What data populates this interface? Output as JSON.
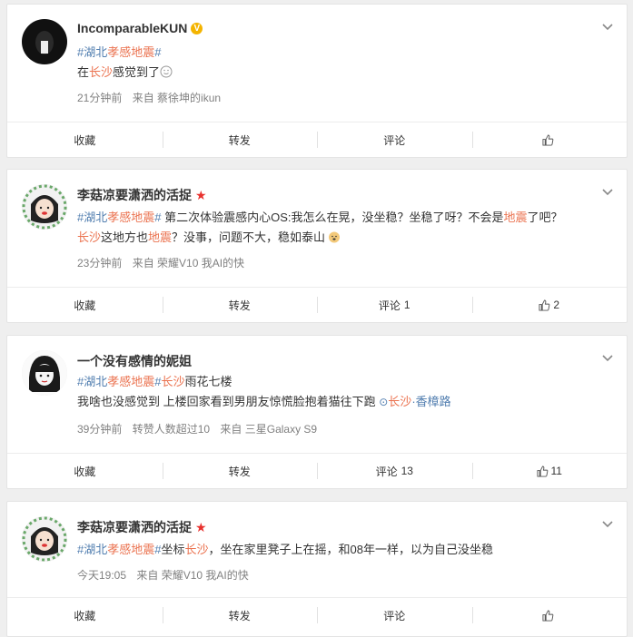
{
  "posts": [
    {
      "username": "IncomparableKUN",
      "badge": "V",
      "text_parts": [
        {
          "t": "#湖北",
          "c": "blue"
        },
        {
          "t": "孝感地震",
          "c": "tag"
        },
        {
          "t": "#",
          "c": "blue"
        }
      ],
      "line2_parts": [
        {
          "t": "在",
          "c": "plain"
        },
        {
          "t": "长沙",
          "c": "tag"
        },
        {
          "t": "感觉到了",
          "c": "plain"
        }
      ],
      "time": "21分钟前",
      "source": "来自 蔡徐坤的ikun",
      "actions": {
        "forward": "收藏",
        "repost": "转发",
        "comment": "评论",
        "comment_count": "",
        "like_count": ""
      }
    },
    {
      "username": "李菇凉要潇洒的活捉",
      "badge": "★",
      "line1": "#湖北孝感地震# 第二次体验震感内心OS:我怎么在晃，没坐稳？坐稳了呀？不会是地震了吧？",
      "line2": "长沙这地方也地震？没事，问题不大，稳如泰山",
      "time": "23分钟前",
      "source": "来自 荣耀V10 我AI的快",
      "actions": {
        "forward": "收藏",
        "repost": "转发",
        "comment": "评论",
        "comment_count": "1",
        "like_count": "2"
      }
    },
    {
      "username": "一个没有感情的妮姐",
      "line1": "#湖北孝感地震#长沙雨花七楼",
      "line2": "我啥也没感觉到 上楼回家看到男朋友惊慌脸抱着猫往下跑",
      "location": "长沙·香樟路",
      "time": "39分钟前",
      "reposts_note": "转赞人数超过10",
      "source": "来自 三星Galaxy S9",
      "actions": {
        "forward": "收藏",
        "repost": "转发",
        "comment": "评论",
        "comment_count": "13",
        "like_count": "11"
      }
    },
    {
      "username": "李菇凉要潇洒的活捉",
      "badge": "★",
      "line1": "#湖北孝感地震#坐标长沙，坐在家里凳子上在摇，和08年一样，以为自己没坐稳",
      "time": "今天19:05",
      "source": "来自 荣耀V10 我AI的快",
      "actions": {
        "forward": "收藏",
        "repost": "转发",
        "comment": "评论",
        "comment_count": "",
        "like_count": ""
      }
    }
  ],
  "colors": {
    "tag": "#eb7350",
    "link": "#507daf",
    "meta": "#808080"
  }
}
